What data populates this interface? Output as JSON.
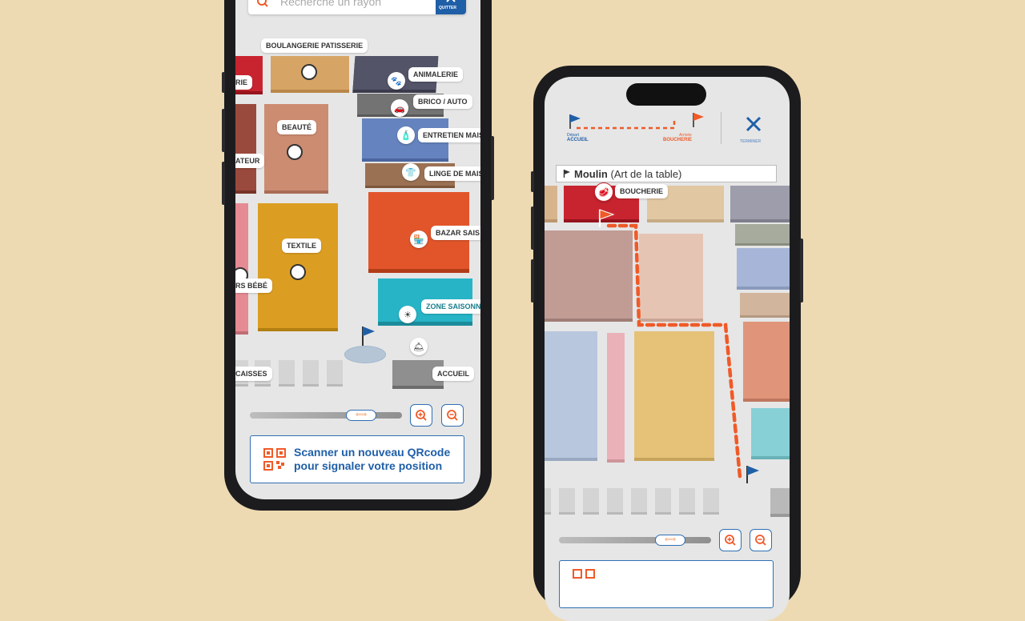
{
  "phone1": {
    "search": {
      "placeholder": "Recherche un rayon",
      "quit_label": "QUITTER"
    },
    "labels": {
      "boulangerie": "BOULANGERIE PATISSERIE",
      "animalerie": "ANIMALERIE",
      "brico": "BRICO / AUTO",
      "entretien": "ENTRETIEN MAIS",
      "linge": "LINGE DE MAIS",
      "bazar": "BAZAR SAIS",
      "zone_saison": "ZONE SAISONN",
      "beaute": "BEAUTÉ",
      "textile": "TEXTILE",
      "rie": "RIE",
      "ateur": "ATEUR",
      "bebe": "RS BÉBÉ",
      "caisses": "CAISSES",
      "accueil": "ACCUEIL"
    },
    "scan_text": [
      "Scanner un nouveau QRcode",
      "pour signaler votre position"
    ]
  },
  "phone2": {
    "route": {
      "start_caption": "Départ",
      "start_name": "ACCUEIL",
      "end_caption": "Arrivée",
      "end_name": "BOUCHERIE",
      "finish_label": "TERMINER"
    },
    "search_bold": "Moulin",
    "search_rest": " (Art de la table)",
    "labels": {
      "boucherie": "BOUCHERIE"
    }
  },
  "colors": {
    "accent_blue": "#1f5fa8",
    "route_orange": "#f05a28",
    "background": "#eedab2"
  }
}
